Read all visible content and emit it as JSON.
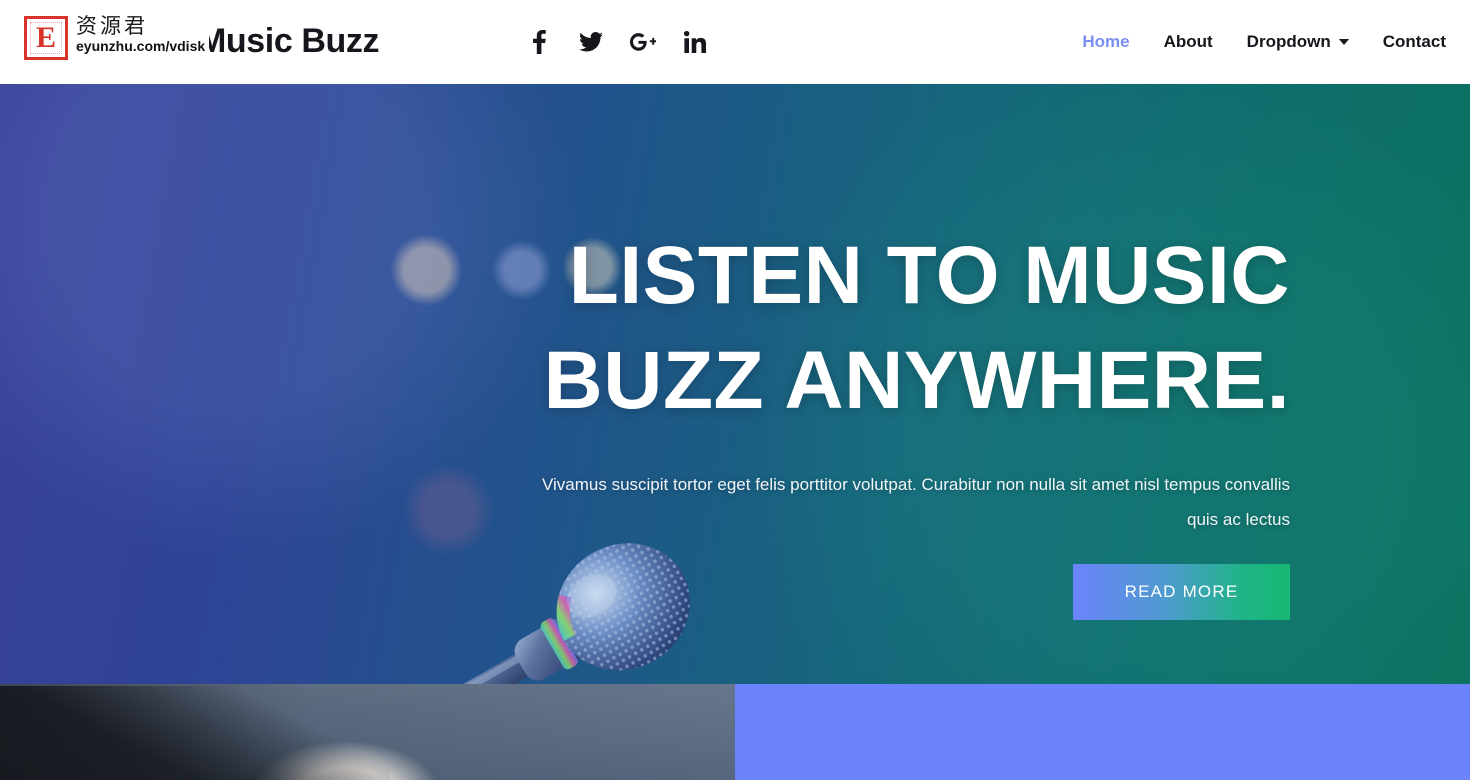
{
  "header": {
    "brand": "Music Buzz",
    "watermark": {
      "badge_letter": "E",
      "cn_text": "资源君",
      "url": "eyunzhu.com/vdisk"
    },
    "social": [
      {
        "name": "facebook-icon",
        "label": "Facebook"
      },
      {
        "name": "twitter-icon",
        "label": "Twitter"
      },
      {
        "name": "google-plus-icon",
        "label": "Google Plus"
      },
      {
        "name": "linkedin-icon",
        "label": "LinkedIn"
      }
    ],
    "nav": [
      {
        "label": "Home",
        "active": true
      },
      {
        "label": "About",
        "active": false
      },
      {
        "label": "Dropdown",
        "active": false,
        "has_caret": true
      },
      {
        "label": "Contact",
        "active": false
      }
    ]
  },
  "hero": {
    "title_line1": "LISTEN TO MUSIC",
    "title_line2": "BUZZ ANYWHERE.",
    "subtitle": "Vivamus suscipit tortor eget felis porttitor volutpat. Curabitur non nulla sit amet nisl tempus convallis quis ac lectus",
    "button_label": "READ MORE"
  },
  "colors": {
    "accent_blue": "#6b84fd",
    "accent_green": "#18b773",
    "nav_active": "#7b8ff0",
    "nav_text": "#15171c",
    "hero_gradient_start": "#3a4099",
    "hero_gradient_end": "#0a765c",
    "panel_blue": "#6b84fd",
    "watermark_red": "#d9342b"
  }
}
